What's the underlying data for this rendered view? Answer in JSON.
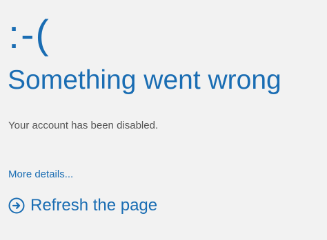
{
  "error_face": ":-(",
  "title": "Something went wrong",
  "message": "Your account has been disabled.",
  "more_details_label": "More details...",
  "refresh": {
    "label": "Refresh the page",
    "icon": "arrow-right-circle-icon"
  },
  "colors": {
    "background": "#f2f2f2",
    "accent": "#1a6db3",
    "body_text": "#555555"
  }
}
